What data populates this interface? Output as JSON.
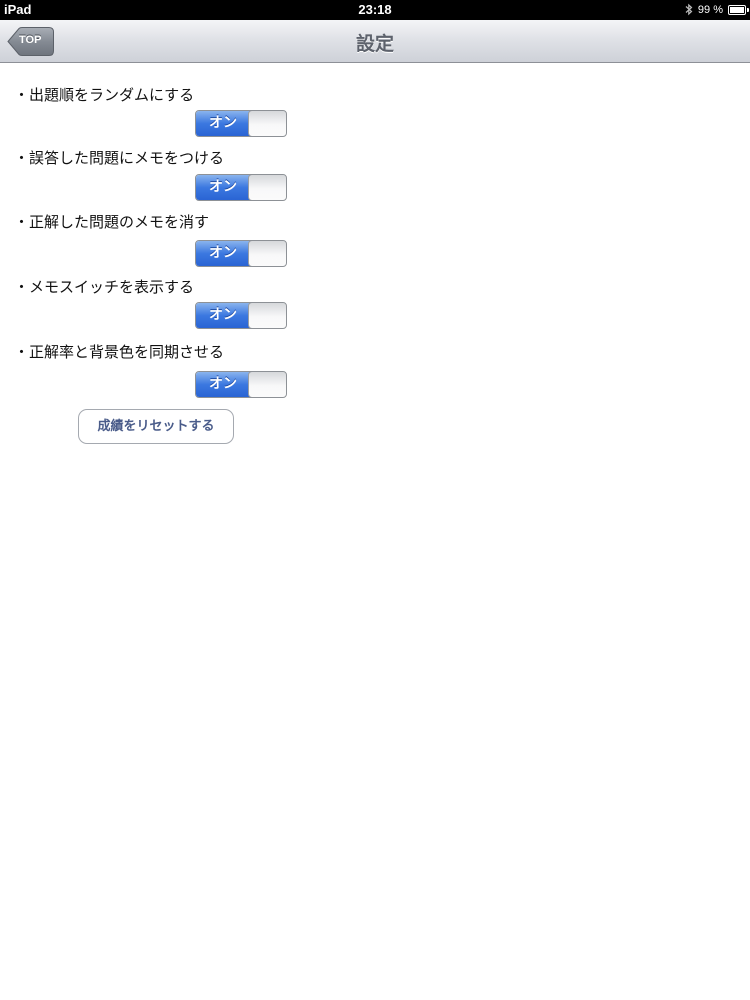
{
  "status_bar": {
    "device": "iPad",
    "time": "23:18",
    "battery": "99 %",
    "battery_level": 0.99,
    "icons": [
      "bluetooth-icon",
      "battery-icon"
    ]
  },
  "nav": {
    "title": "設定",
    "back_label": "TOP"
  },
  "settings": [
    {
      "label": "・出題順をランダムにする",
      "toggle_label": "オン",
      "on": true
    },
    {
      "label": "・誤答した問題にメモをつける",
      "toggle_label": "オン",
      "on": true
    },
    {
      "label": "・正解した問題のメモを消す",
      "toggle_label": "オン",
      "on": true
    },
    {
      "label": "・メモスイッチを表示する",
      "toggle_label": "オン",
      "on": true
    },
    {
      "label": "・正解率と背景色を同期させる",
      "toggle_label": "オン",
      "on": true
    }
  ],
  "reset_button_label": "成績をリセットする",
  "colors": {
    "toggle_on": "#3b78e0",
    "status_bar": "#000000",
    "nav_title": "#5d626c",
    "button_text": "#4a5c8a"
  }
}
